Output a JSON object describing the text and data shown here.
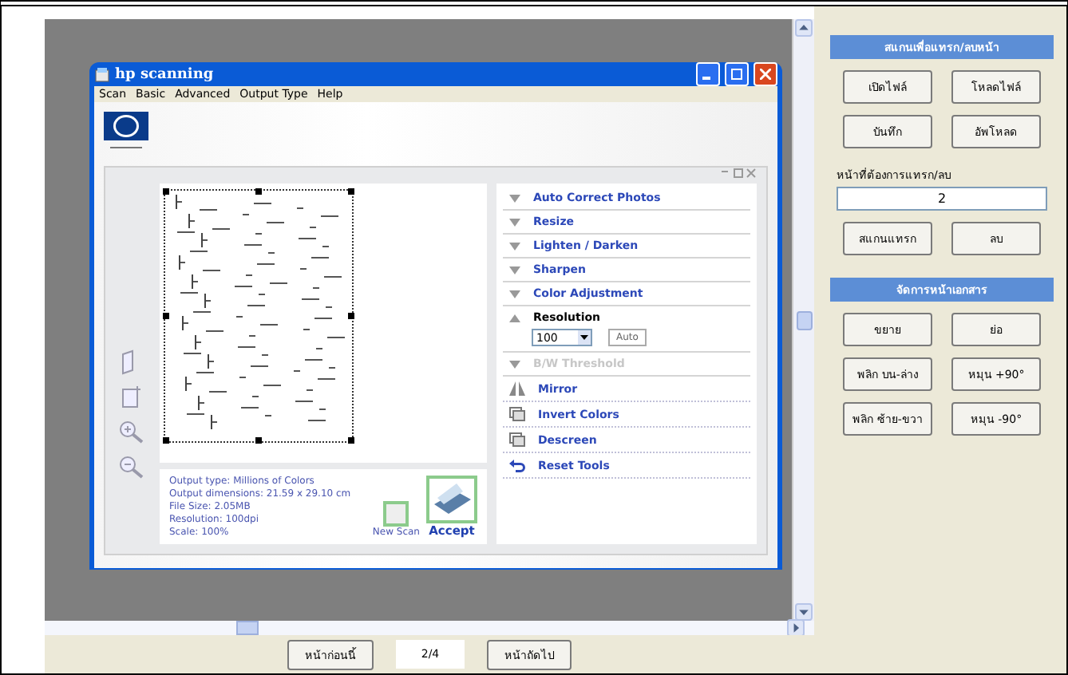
{
  "scanner_window": {
    "title": "hp scanning",
    "menu": [
      "Scan",
      "Basic",
      "Advanced",
      "Output Type",
      "Help"
    ],
    "tools": [
      {
        "kind": "collapsed",
        "label": "Auto Correct Photos"
      },
      {
        "kind": "collapsed",
        "label": "Resize"
      },
      {
        "kind": "collapsed",
        "label": "Lighten / Darken"
      },
      {
        "kind": "collapsed",
        "label": "Sharpen"
      },
      {
        "kind": "collapsed",
        "label": "Color Adjustment"
      },
      {
        "kind": "expanded",
        "label": "Resolution",
        "select_value": "100",
        "button": "Auto"
      },
      {
        "kind": "disabled",
        "label": "B/W Threshold"
      },
      {
        "kind": "mirror",
        "label": "Mirror"
      },
      {
        "kind": "invert",
        "label": "Invert Colors"
      },
      {
        "kind": "descreen",
        "label": "Descreen"
      },
      {
        "kind": "reset",
        "label": "Reset Tools"
      }
    ],
    "info": [
      "Output type: Millions of Colors",
      "Output dimensions: 21.59 x 29.10 cm",
      "File Size: 2.05MB",
      "Resolution:  100dpi",
      "Scale: 100%"
    ],
    "new_scan": "New Scan",
    "accept": "Accept"
  },
  "side_panel": {
    "sections": [
      {
        "header": "สแกนเพื่อแทรก/ลบหน้า",
        "buttons": [
          "เปิดไฟล์",
          "โหลดไฟล์",
          "บันทึก",
          "อัพโหลด"
        ],
        "field_label": "หน้าที่ต้องการแทรก/ลบ",
        "field_value": "2",
        "actions": [
          "สแกนแทรก",
          "ลบ"
        ]
      },
      {
        "header": "จัดการหน้าเอกสาร",
        "buttons": [
          "ขยาย",
          "ย่อ",
          "พลิก บน-ล่าง",
          "หมุน +90°",
          "พลิก ซ้าย-ขวา",
          "หมุน -90°"
        ]
      }
    ]
  },
  "pager": {
    "previous": "หน้าก่อนนี้",
    "page": "2/4",
    "next": "หน้าถัดไป"
  }
}
